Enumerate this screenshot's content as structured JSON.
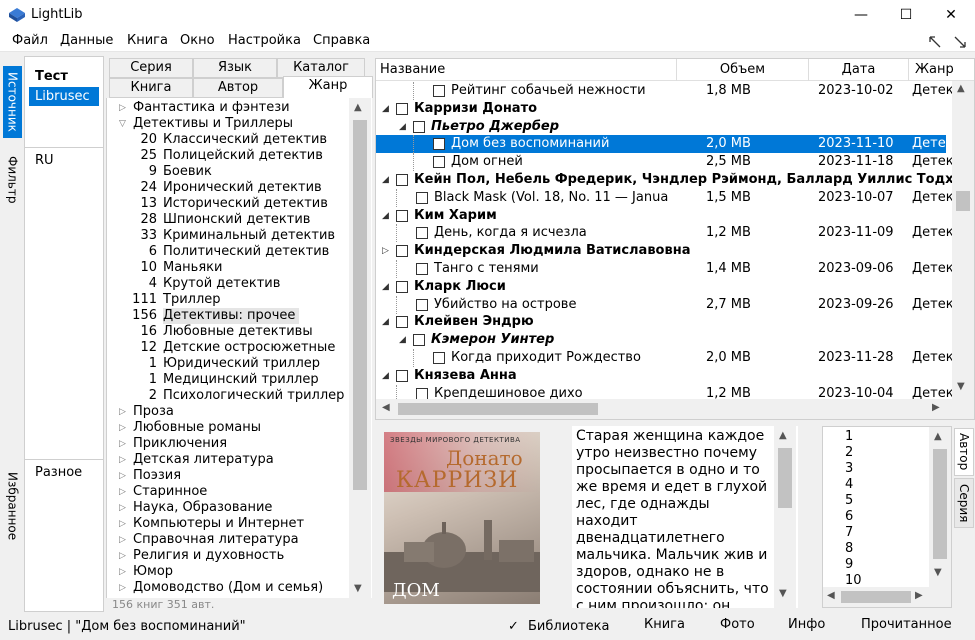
{
  "window": {
    "title": "LightLib",
    "min_glyph": "—",
    "max_glyph": "☐",
    "close_glyph": "✕"
  },
  "menu": [
    "Файл",
    "Данные",
    "Книга",
    "Окно",
    "Настройка",
    "Справка"
  ],
  "left_tabs": [
    "Источник",
    "Фильтр",
    "Избранное"
  ],
  "source": {
    "title": "Тест",
    "selected": "Librusec",
    "filter_value": "RU",
    "favorites": "Разное"
  },
  "genre_tabs_top": [
    "Серия",
    "Язык",
    "Каталог"
  ],
  "genre_tabs_bottom": [
    "Книга",
    "Автор",
    "Жанр"
  ],
  "genres": [
    {
      "count": "",
      "label": "Фантастика и фэнтези",
      "level": 0,
      "arrow": "▷"
    },
    {
      "count": "",
      "label": "Детективы и Триллеры",
      "level": 0,
      "arrow": "▽"
    },
    {
      "count": "20",
      "label": "Классический детектив",
      "level": 1
    },
    {
      "count": "25",
      "label": "Полицейский детектив",
      "level": 1
    },
    {
      "count": "9",
      "label": "Боевик",
      "level": 1
    },
    {
      "count": "24",
      "label": "Иронический детектив",
      "level": 1
    },
    {
      "count": "13",
      "label": "Исторический детектив",
      "level": 1
    },
    {
      "count": "28",
      "label": "Шпионский детектив",
      "level": 1
    },
    {
      "count": "33",
      "label": "Криминальный детектив",
      "level": 1
    },
    {
      "count": "6",
      "label": "Политический детектив",
      "level": 1
    },
    {
      "count": "10",
      "label": "Маньяки",
      "level": 1
    },
    {
      "count": "4",
      "label": "Крутой детектив",
      "level": 1
    },
    {
      "count": "111",
      "label": "Триллер",
      "level": 1
    },
    {
      "count": "156",
      "label": "Детективы: прочее",
      "level": 1,
      "highlight": true
    },
    {
      "count": "16",
      "label": "Любовные детективы",
      "level": 1
    },
    {
      "count": "12",
      "label": "Детские остросюжетные",
      "level": 1
    },
    {
      "count": "1",
      "label": "Юридический триллер",
      "level": 1
    },
    {
      "count": "1",
      "label": "Медицинский триллер",
      "level": 1
    },
    {
      "count": "2",
      "label": "Психологический триллер",
      "level": 1
    },
    {
      "count": "",
      "label": "Проза",
      "level": 0,
      "arrow": "▷"
    },
    {
      "count": "",
      "label": "Любовные романы",
      "level": 0,
      "arrow": "▷"
    },
    {
      "count": "",
      "label": "Приключения",
      "level": 0,
      "arrow": "▷"
    },
    {
      "count": "",
      "label": "Детская литература",
      "level": 0,
      "arrow": "▷"
    },
    {
      "count": "",
      "label": "Поэзия",
      "level": 0,
      "arrow": "▷"
    },
    {
      "count": "",
      "label": "Старинное",
      "level": 0,
      "arrow": "▷"
    },
    {
      "count": "",
      "label": "Наука, Образование",
      "level": 0,
      "arrow": "▷"
    },
    {
      "count": "",
      "label": "Компьютеры и Интернет",
      "level": 0,
      "arrow": "▷"
    },
    {
      "count": "",
      "label": "Справочная литература",
      "level": 0,
      "arrow": "▷"
    },
    {
      "count": "",
      "label": "Религия и духовность",
      "level": 0,
      "arrow": "▷"
    },
    {
      "count": "",
      "label": "Юмор",
      "level": 0,
      "arrow": "▷"
    },
    {
      "count": "",
      "label": "Домоводство (Дом и семья)",
      "level": 0,
      "arrow": "▷"
    }
  ],
  "genre_footer": "156 книг 351 авт.",
  "columns": [
    "Название",
    "Объем",
    "Дата",
    "Жанр"
  ],
  "rows": [
    {
      "type": "book",
      "indent": 3,
      "title": "Рейтинг собачьей нежности",
      "size": "1,8 MB",
      "date": "2023-10-02",
      "genre": "Детект"
    },
    {
      "type": "author",
      "indent": 0,
      "title": "Карризи Донато"
    },
    {
      "type": "series",
      "indent": 1,
      "title": "Пьетро Джербер"
    },
    {
      "type": "book",
      "indent": 3,
      "title": "Дом без воспоминаний",
      "size": "2,0 MB",
      "date": "2023-11-10",
      "genre": "Детект",
      "selected": true
    },
    {
      "type": "book",
      "indent": 3,
      "title": "Дом огней",
      "size": "2,5 MB",
      "date": "2023-11-18",
      "genre": "Детект"
    },
    {
      "type": "author",
      "indent": 0,
      "title": "Кейн Пол, Небель Фредерик, Чэндлер Рэймонд, Баллард Уиллис Тодха"
    },
    {
      "type": "book",
      "indent": 2,
      "title": "Black Mask (Vol. 18, No. 11 — Janua",
      "size": "1,5 MB",
      "date": "2023-10-07",
      "genre": "Детект"
    },
    {
      "type": "author",
      "indent": 0,
      "title": "Ким Харим"
    },
    {
      "type": "book",
      "indent": 2,
      "title": "День, когда я исчезла",
      "size": "1,2 MB",
      "date": "2023-11-09",
      "genre": "Детект"
    },
    {
      "type": "author",
      "indent": 0,
      "title": "Киндерская Людмила Ватиславовна",
      "collapsed": true
    },
    {
      "type": "book",
      "indent": 2,
      "title": "Танго с тенями",
      "size": "1,4 MB",
      "date": "2023-09-06",
      "genre": "Детект"
    },
    {
      "type": "author",
      "indent": 0,
      "title": "Кларк Люси"
    },
    {
      "type": "book",
      "indent": 2,
      "title": "Убийство на острове",
      "size": "2,7 MB",
      "date": "2023-09-26",
      "genre": "Детект"
    },
    {
      "type": "author",
      "indent": 0,
      "title": "Клейвен Эндрю"
    },
    {
      "type": "series",
      "indent": 1,
      "title": "Кэмерон Уинтер"
    },
    {
      "type": "book",
      "indent": 3,
      "title": "Когда приходит Рождество",
      "size": "2,0 MB",
      "date": "2023-11-28",
      "genre": "Детект"
    },
    {
      "type": "author",
      "indent": 0,
      "title": "Князева Анна"
    },
    {
      "type": "book",
      "indent": 2,
      "title": "Крепдешиновое дихо",
      "size": "1,2 MB",
      "date": "2023-10-04",
      "genre": "Детект"
    }
  ],
  "cover": {
    "top_text": "ЗВЕЗДЫ МИРОВОГО ДЕТЕКТИВА",
    "author1": "Донато",
    "author2": "КАРРИЗИ",
    "bottom": "ДОМ"
  },
  "annotation": "Старая женщина каждое утро неизвестно почему просыпается в одно и то же время и едет в глухой лес, где однажды находит двенадцатилетнего мальчика. Мальчик жив и здоров, однако не в состоянии объяснить, что с ним произошло: он вообще не говорит. Единственный",
  "numbers": [
    "1",
    "2",
    "3",
    "4",
    "5",
    "6",
    "7",
    "8",
    "9",
    "10"
  ],
  "right_tabs": [
    "Автор",
    "Серия"
  ],
  "status": {
    "left": "Librusec | \"Дом без воспоминаний\"",
    "tabs": [
      "Библиотека",
      "Книга",
      "Фото",
      "Инфо",
      "Прочитанное"
    ],
    "check": "✓"
  },
  "colors": {
    "selection": "#0078d7",
    "highlight": "#e5e5e5"
  }
}
